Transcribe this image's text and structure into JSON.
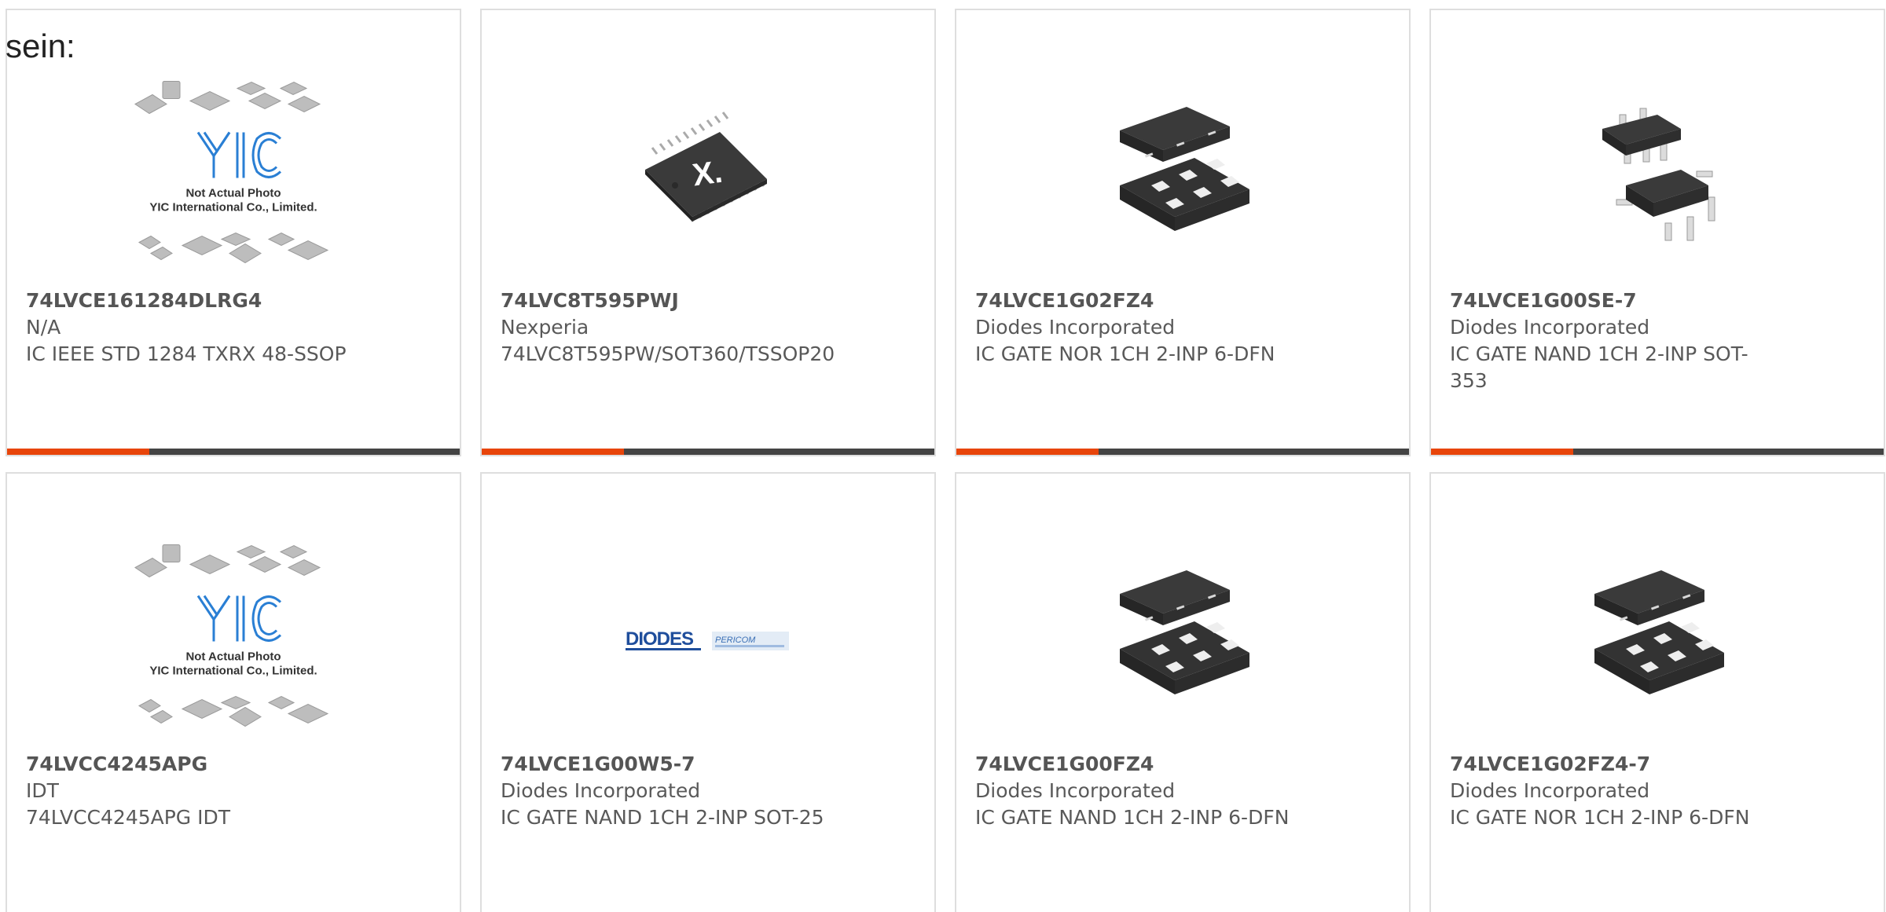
{
  "lead_text": "sein:",
  "colors": {
    "accent": "#e8450a",
    "bar": "#444444",
    "border": "#dedede",
    "yic_blue": "#2a7fd4",
    "chip_dark": "#3a3a3a",
    "diodes_blue": "#1f4e9c"
  },
  "products": [
    {
      "part_number": "74LVCE161284DLRG4",
      "manufacturer": "N/A",
      "description": "IC IEEE STD 1284 TXRX 48-SSOP",
      "image": "yic-placeholder",
      "image_caption_1": "Not Actual Photo",
      "image_caption_2": "YIC International Co., Limited.",
      "logo_text": "YIC"
    },
    {
      "part_number": "74LVC8T595PWJ",
      "manufacturer": "Nexperia",
      "description": "74LVC8T595PW/SOT360/TSSOP20",
      "image": "tssop-chip",
      "logo_text": "X."
    },
    {
      "part_number": "74LVCE1G02FZ4",
      "manufacturer": "Diodes Incorporated",
      "description": "IC GATE NOR 1CH 2-INP 6-DFN",
      "image": "dfn-package"
    },
    {
      "part_number": "74LVCE1G00SE-7",
      "manufacturer": "Diodes Incorporated",
      "description": "IC GATE NAND 1CH 2-INP SOT-353",
      "image": "sot353-package"
    },
    {
      "part_number": "74LVCC4245APG",
      "manufacturer": "IDT",
      "description": "74LVCC4245APG IDT",
      "image": "yic-placeholder",
      "image_caption_1": "Not Actual Photo",
      "image_caption_2": "YIC International Co., Limited.",
      "logo_text": "YIC"
    },
    {
      "part_number": "74LVCE1G00W5-7",
      "manufacturer": "Diodes Incorporated",
      "description": "IC GATE NAND 1CH 2-INP SOT-25",
      "image": "diodes-logo",
      "logo_text": "DIODES",
      "logo_text_2": "PERICOM"
    },
    {
      "part_number": "74LVCE1G00FZ4",
      "manufacturer": "Diodes Incorporated",
      "description": "IC GATE NAND 1CH 2-INP 6-DFN",
      "image": "dfn-package"
    },
    {
      "part_number": "74LVCE1G02FZ4-7",
      "manufacturer": "Diodes Incorporated",
      "description": "IC GATE NOR 1CH 2-INP 6-DFN",
      "image": "dfn-package"
    }
  ]
}
